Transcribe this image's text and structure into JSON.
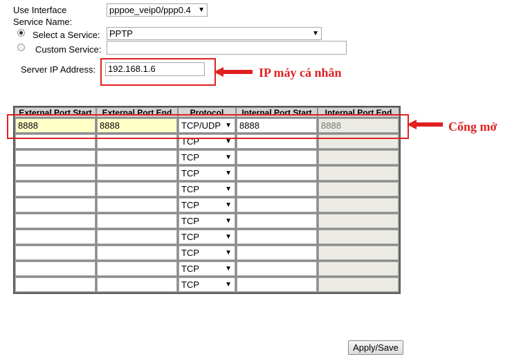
{
  "form": {
    "use_interface_label": "Use Interface",
    "use_interface_value": "pppoe_veip0/ppp0.4",
    "service_name_label": "Service Name:",
    "select_service_label": "Select a Service:",
    "select_service_value": "PPTP",
    "custom_service_label": "Custom Service:",
    "custom_service_value": "",
    "server_ip_label": "Server IP Address:",
    "server_ip_value": "192.168.1.6"
  },
  "annotations": {
    "ip_note": "IP máy cá nhân",
    "port_note": "Cổng mở"
  },
  "table": {
    "headers": [
      "External Port Start",
      "External Port End",
      "Protocol",
      "Internal Port Start",
      "Internal Port End"
    ],
    "rows": [
      {
        "ext_start": "8888",
        "ext_end": "8888",
        "protocol": "TCP/UDP",
        "int_start": "8888",
        "int_end": "8888"
      },
      {
        "ext_start": "",
        "ext_end": "",
        "protocol": "TCP",
        "int_start": "",
        "int_end": ""
      },
      {
        "ext_start": "",
        "ext_end": "",
        "protocol": "TCP",
        "int_start": "",
        "int_end": ""
      },
      {
        "ext_start": "",
        "ext_end": "",
        "protocol": "TCP",
        "int_start": "",
        "int_end": ""
      },
      {
        "ext_start": "",
        "ext_end": "",
        "protocol": "TCP",
        "int_start": "",
        "int_end": ""
      },
      {
        "ext_start": "",
        "ext_end": "",
        "protocol": "TCP",
        "int_start": "",
        "int_end": ""
      },
      {
        "ext_start": "",
        "ext_end": "",
        "protocol": "TCP",
        "int_start": "",
        "int_end": ""
      },
      {
        "ext_start": "",
        "ext_end": "",
        "protocol": "TCP",
        "int_start": "",
        "int_end": ""
      },
      {
        "ext_start": "",
        "ext_end": "",
        "protocol": "TCP",
        "int_start": "",
        "int_end": ""
      },
      {
        "ext_start": "",
        "ext_end": "",
        "protocol": "TCP",
        "int_start": "",
        "int_end": ""
      },
      {
        "ext_start": "",
        "ext_end": "",
        "protocol": "TCP",
        "int_start": "",
        "int_end": ""
      }
    ]
  },
  "buttons": {
    "apply_save": "Apply/Save"
  },
  "icons": {
    "dropdown_arrow": "▼",
    "red_arrow": "arrow-left-icon"
  },
  "colors": {
    "annotation_red": "#e02020",
    "autofill_yellow": "#ffffc8",
    "disabled_gray": "#ebebe4"
  }
}
